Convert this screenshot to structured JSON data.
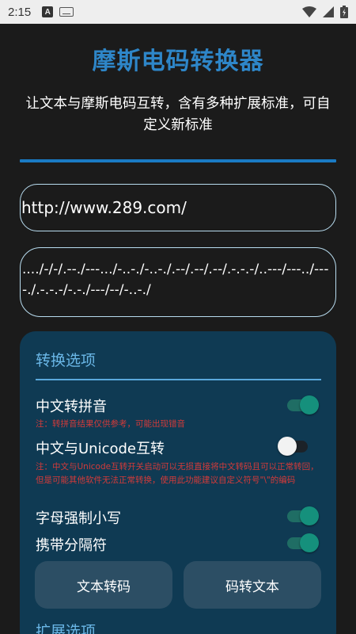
{
  "status": {
    "time": "2:15",
    "a_badge": "A"
  },
  "app": {
    "title": "摩斯电码转换器",
    "subtitle": "让文本与摩斯电码互转，含有多种扩展标准，可自定义新标准"
  },
  "input": {
    "value": "http://www.289.com/"
  },
  "output": {
    "morse": "..../-/-/.--./---.../-..-./-..-./.--/.--/.--/.-.-.-/..---/---../----./.-.-.-/-.-./---/--/-..-./"
  },
  "options": {
    "section_title": "转换选项",
    "pinyin": {
      "label": "中文转拼音",
      "note": "注：转拼音结果仅供参考，可能出现错音",
      "on": true
    },
    "unicode": {
      "label": "中文与Unicode互转",
      "note": "注：中文与Unicode互转开关启动可以无损直接将中文转码且可以正常转回，但是可能其他软件无法正常转换，使用此功能建议自定义符号\"\\\"的编码",
      "on": false
    },
    "lowercase": {
      "label": "字母强制小写",
      "on": true
    },
    "separator": {
      "label": "携带分隔符",
      "on": true
    },
    "encode_button": "文本转码",
    "decode_button": "码转文本"
  },
  "extended": {
    "section_title": "扩展选项"
  },
  "colors": {
    "accent": "#2e86c8",
    "panel": "#0f3a53",
    "note": "#d33a3a",
    "switch_on": "#15907c"
  }
}
